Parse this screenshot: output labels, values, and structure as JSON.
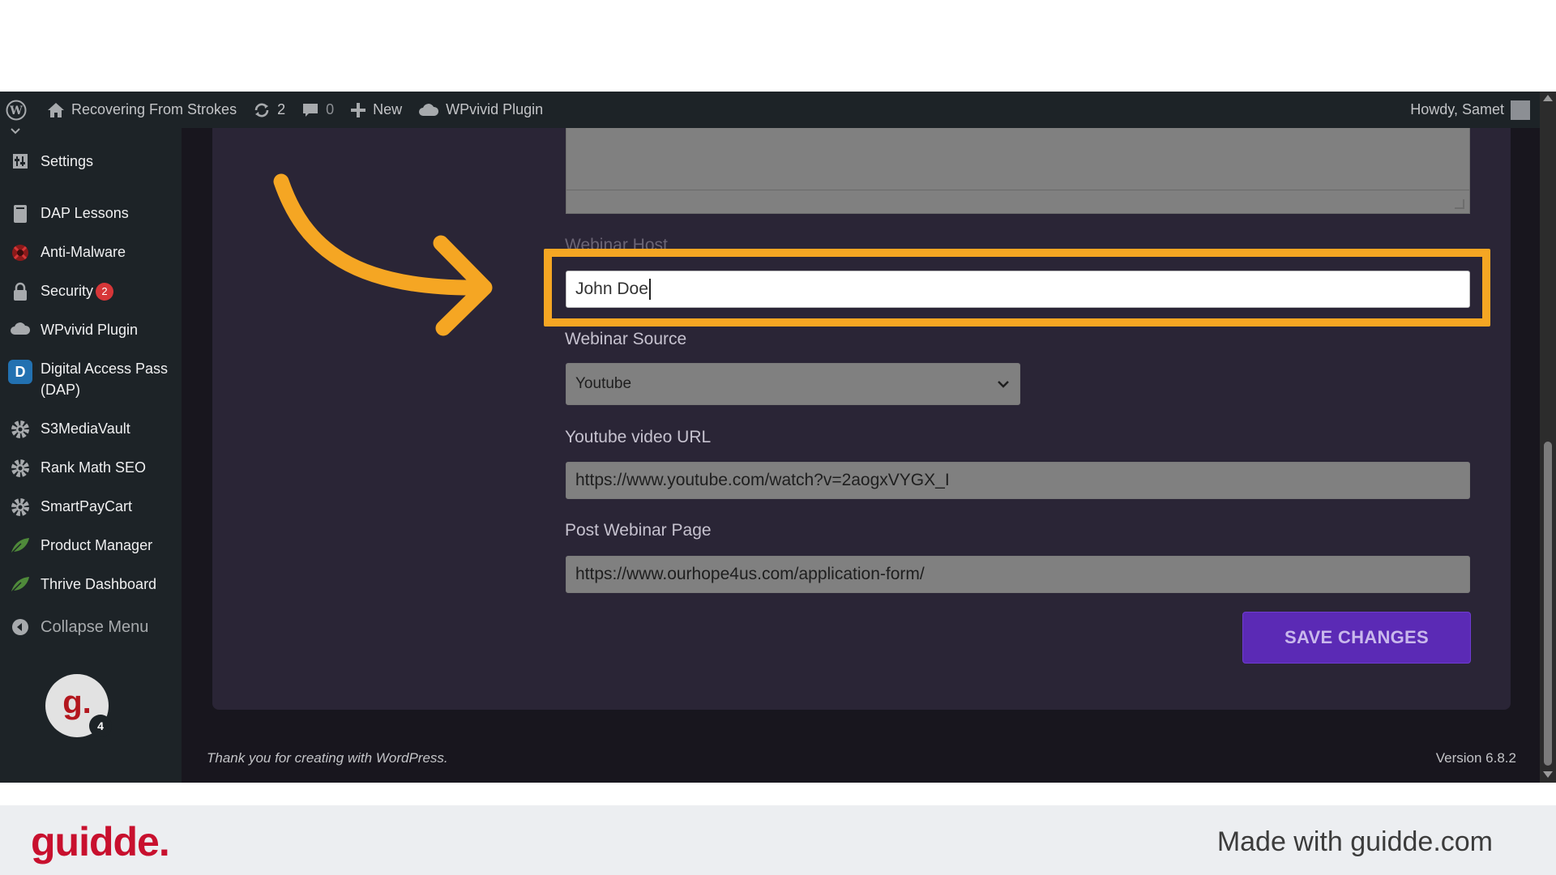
{
  "adminbar": {
    "site_name": "Recovering From Strokes",
    "updates_count": "2",
    "comments_count": "0",
    "new_label": "New",
    "plugin_label": "WPvivid Plugin",
    "howdy": "Howdy, Samet"
  },
  "sidebar": {
    "items": [
      {
        "label": "Settings",
        "icon": "settings-icon"
      },
      {
        "label": "DAP Lessons",
        "icon": "book-icon"
      },
      {
        "label": "Anti-Malware",
        "icon": "shield-malware-icon"
      },
      {
        "label": "Security",
        "icon": "lock-icon",
        "badge": "2"
      },
      {
        "label": "WPvivid Plugin",
        "icon": "cloud-icon"
      },
      {
        "label": "Digital Access Pass (DAP)",
        "icon": "dap-icon",
        "icon_letter": "D"
      },
      {
        "label": "S3MediaVault",
        "icon": "gear-icon"
      },
      {
        "label": "Rank Math SEO",
        "icon": "gear-icon"
      },
      {
        "label": "SmartPayCart",
        "icon": "gear-icon"
      },
      {
        "label": "Product Manager",
        "icon": "leaf-icon"
      },
      {
        "label": "Thrive Dashboard",
        "icon": "leaf-icon"
      },
      {
        "label": "Collapse Menu",
        "icon": "collapse-icon"
      }
    ],
    "avatar_letter": "g.",
    "avatar_count": "4"
  },
  "form": {
    "webinar_host_label": "Webinar Host",
    "webinar_host_value": "John Doe",
    "webinar_source_label": "Webinar Source",
    "webinar_source_value": "Youtube",
    "youtube_url_label": "Youtube video URL",
    "youtube_url_value": "https://www.youtube.com/watch?v=2aogxVYGX_I",
    "post_webinar_label": "Post Webinar Page",
    "post_webinar_value": "https://www.ourhope4us.com/application-form/",
    "save_label": "SAVE CHANGES"
  },
  "footer": {
    "thanks": "Thank you for creating with WordPress.",
    "version": "Version 6.8.2"
  },
  "branding": {
    "logo": "guidde.",
    "made_with": "Made with guidde.com"
  },
  "colors": {
    "highlight": "#f5a623",
    "save_button": "#5b2ab5",
    "brand_red": "#c8102e"
  }
}
